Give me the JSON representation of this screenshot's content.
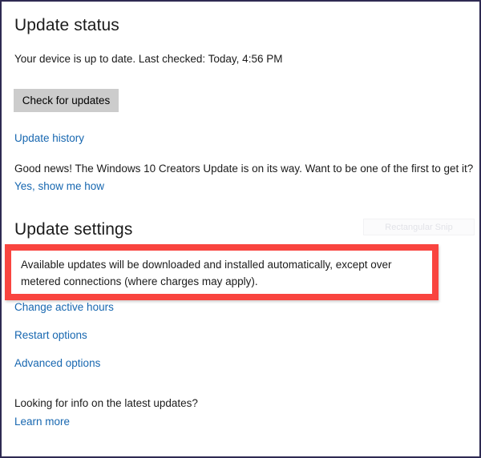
{
  "window": {
    "border_color": "#2e2a52",
    "background": "#ffffff"
  },
  "theme": {
    "link_color": "#1767b0",
    "text_color": "#1b1b1b",
    "button_fill": "#cccccc",
    "callout_red": "#f9443f"
  },
  "update_status": {
    "heading": "Update status",
    "status_line": "Your device is up to date. Last checked: Today, 4:56 PM",
    "check_button_label": "Check for updates",
    "history_link": "Update history",
    "creators_message": "Good news! The Windows 10 Creators Update is on its way. Want to be one of the first to get it?",
    "creators_cta_link": "Yes, show me how"
  },
  "update_settings": {
    "heading": "Update settings",
    "description": "Available updates will be downloaded and installed automatically, except over metered connections (where charges may apply).",
    "links": [
      {
        "label": "Change active hours"
      },
      {
        "label": "Restart options"
      },
      {
        "label": "Advanced options"
      }
    ]
  },
  "footer": {
    "prompt": "Looking for info on the latest updates?",
    "learn_more_link": "Learn more"
  },
  "overlay": {
    "ghost_tooltip": "Rectangular Snip"
  }
}
